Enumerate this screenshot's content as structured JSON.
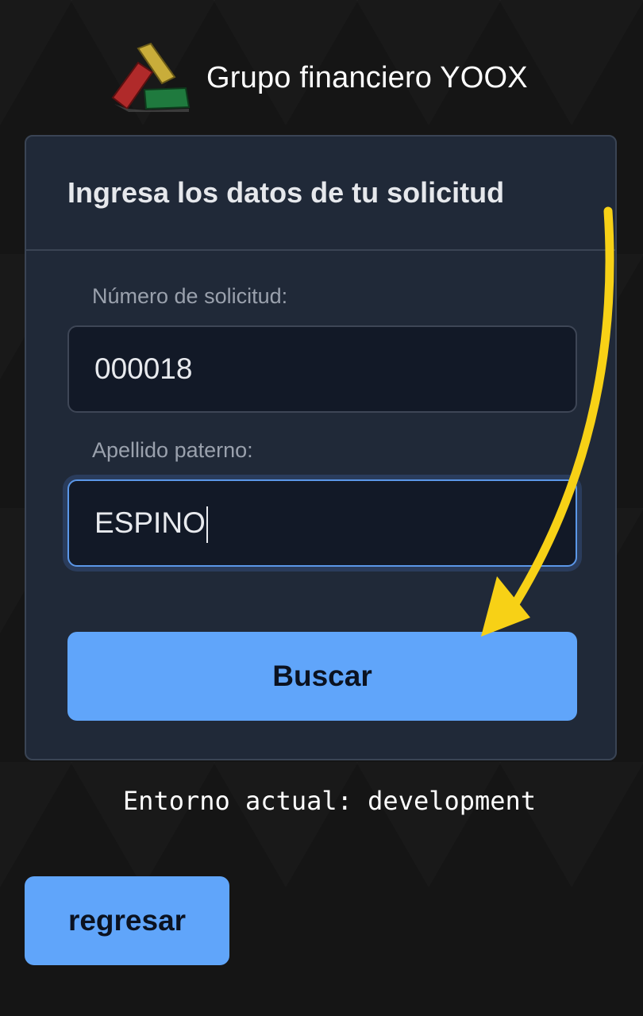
{
  "header": {
    "brand_title": "Grupo financiero YOOX",
    "logo_icon": "yoox-logo-icon"
  },
  "form": {
    "title": "Ingresa los datos de tu solicitud",
    "request_number_label": "Número de solicitud:",
    "request_number_value": "000018",
    "surname_label": "Apellido paterno:",
    "surname_value": "ESPINO",
    "search_label": "Buscar"
  },
  "footer": {
    "environment_text": "Entorno actual: development",
    "back_label": "regresar"
  },
  "colors": {
    "accent": "#60a5fa",
    "card_bg": "#202938",
    "input_bg": "#121927",
    "annotation_arrow": "#f7d116"
  }
}
